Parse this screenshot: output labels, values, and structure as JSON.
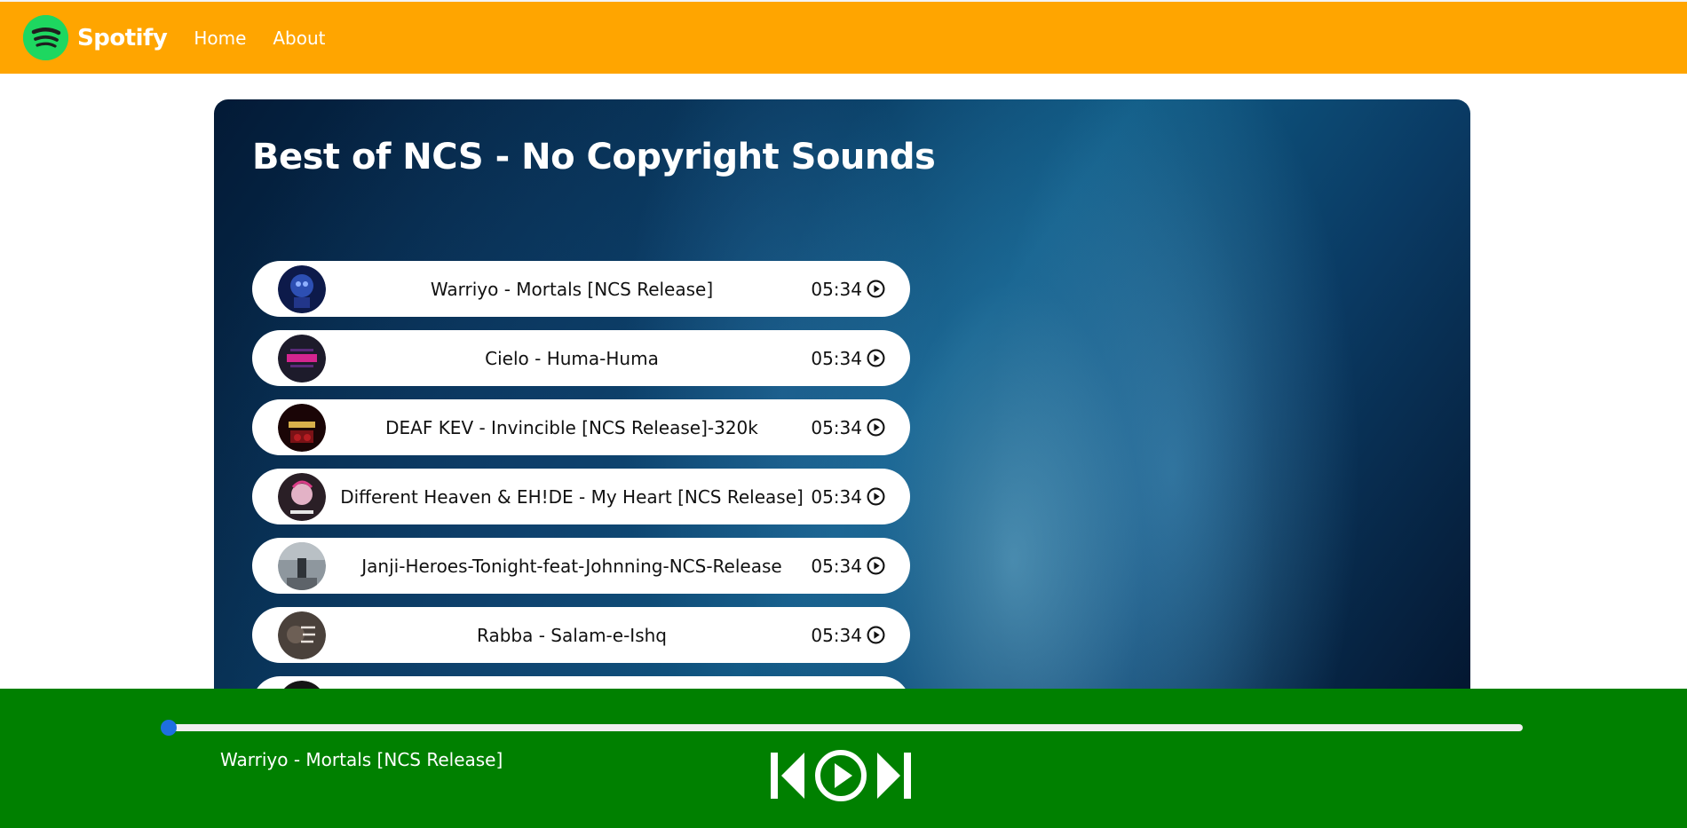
{
  "navbar": {
    "brand": "Spotify",
    "links": [
      "Home",
      "About"
    ],
    "logo_icon": "spotify-logo",
    "background": "#ffa500"
  },
  "playlist": {
    "title": "Best of NCS - No Copyright Sounds",
    "songs": [
      {
        "name": "Warriyo - Mortals [NCS Release]",
        "duration": "05:34",
        "cover_color": "#1b2e6b"
      },
      {
        "name": "Cielo - Huma-Huma",
        "duration": "05:34",
        "cover_color": "#2a1433"
      },
      {
        "name": "DEAF KEV - Invincible [NCS Release]-320k",
        "duration": "05:34",
        "cover_color": "#5a0f12"
      },
      {
        "name": "Different Heaven & EH!DE - My Heart [NCS Release]",
        "duration": "05:34",
        "cover_color": "#3a2530"
      },
      {
        "name": "Janji-Heroes-Tonight-feat-Johnning-NCS-Release",
        "duration": "05:34",
        "cover_color": "#59636b"
      },
      {
        "name": "Rabba - Salam-e-Ishq",
        "duration": "05:34",
        "cover_color": "#4a3c35"
      }
    ],
    "play_icon": "play-circle-icon"
  },
  "player": {
    "now_playing": "Warriyo - Mortals [NCS Release]",
    "progress": 0,
    "background": "#008000",
    "controls": [
      "skip-back-icon",
      "play-circle-icon",
      "skip-forward-icon"
    ]
  }
}
